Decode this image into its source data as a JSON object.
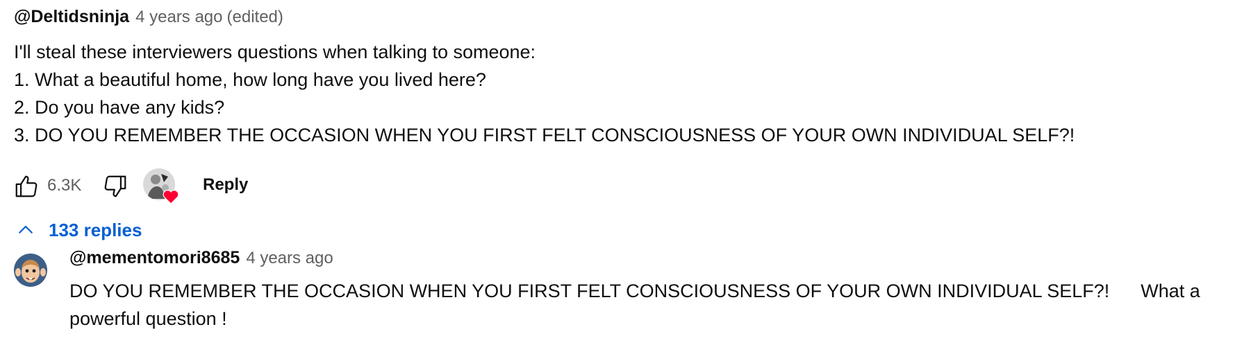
{
  "comment": {
    "author": "@Deltidsninja",
    "time": "4 years ago",
    "edited": "(edited)",
    "lines": [
      "I'll steal these interviewers questions when talking to someone:",
      "1. What a beautiful home, how long have you lived here?",
      "2. Do you have any kids?",
      "3. DO YOU REMEMBER THE OCCASION WHEN YOU FIRST FELT CONSCIOUSNESS OF YOUR OWN INDIVIDUAL SELF?!"
    ],
    "like_count": "6.3K",
    "reply_label": "Reply",
    "creator_heart": true
  },
  "replies_toggle": {
    "label": "133 replies",
    "icon": "chevron-up-icon"
  },
  "reply": {
    "author": "@mementomori8685",
    "time": "4 years ago",
    "text": "DO YOU REMEMBER THE OCCASION WHEN YOU FIRST FELT CONSCIOUSNESS OF YOUR OWN INDIVIDUAL SELF?!      What a powerful question !"
  },
  "colors": {
    "link_blue": "#065fd4",
    "secondary_text": "#606060",
    "heart_red": "#ff0033"
  }
}
